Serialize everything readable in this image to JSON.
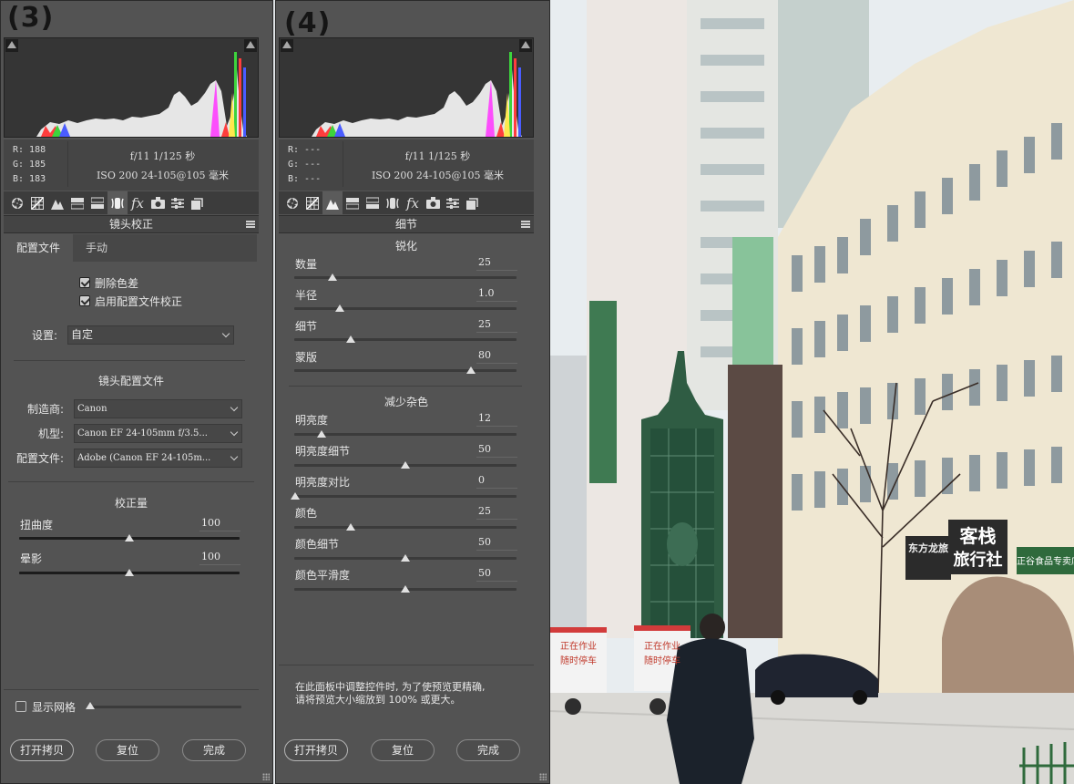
{
  "left": {
    "step": "(3)",
    "rgb": {
      "r": "R: 188",
      "g": "G: 185",
      "b": "B: 183"
    },
    "exif": {
      "line1": "f/11  1/125 秒",
      "line2": "ISO 200  24-105@105 毫米"
    },
    "panel_title": "镜头校正",
    "tabs": {
      "profile": "配置文件",
      "manual": "手动"
    },
    "checks": {
      "remove_ca": "删除色差",
      "enable_profile": "启用配置文件校正"
    },
    "setup": {
      "label": "设置:",
      "value": "自定"
    },
    "lens_profile": {
      "heading": "镜头配置文件",
      "make_label": "制造商:",
      "make_value": "Canon",
      "model_label": "机型:",
      "model_value": "Canon EF 24-105mm f/3.5...",
      "profile_label": "配置文件:",
      "profile_value": "Adobe (Canon EF 24-105m..."
    },
    "correction": {
      "heading": "校正量",
      "distortion_label": "扭曲度",
      "distortion_value": "100",
      "vignetting_label": "晕影",
      "vignetting_value": "100"
    },
    "grid_label": "显示网格",
    "buttons": {
      "open_copy": "打开拷贝",
      "reset": "复位",
      "done": "完成"
    }
  },
  "right": {
    "step": "(4)",
    "rgb": {
      "r": "R: ---",
      "g": "G: ---",
      "b": "B: ---"
    },
    "exif": {
      "line1": "f/11  1/125 秒",
      "line2": "ISO 200  24-105@105 毫米"
    },
    "panel_title": "细节",
    "sharpening": {
      "heading": "锐化",
      "amount_label": "数量",
      "amount_value": "25",
      "radius_label": "半径",
      "radius_value": "1.0",
      "detail_label": "细节",
      "detail_value": "25",
      "masking_label": "蒙版",
      "masking_value": "80"
    },
    "noise": {
      "heading": "减少杂色",
      "lum_label": "明亮度",
      "lum_value": "12",
      "lum_detail_label": "明亮度细节",
      "lum_detail_value": "50",
      "lum_contrast_label": "明亮度对比",
      "lum_contrast_value": "0",
      "color_label": "颜色",
      "color_value": "25",
      "color_detail_label": "颜色细节",
      "color_detail_value": "50",
      "color_smooth_label": "颜色平滑度",
      "color_smooth_value": "50"
    },
    "note_line1": "在此面板中调整控件时, 为了使预览更精确,",
    "note_line2": "请将预览大小缩放到 100% 或更大。",
    "buttons": {
      "open_copy": "打开拷贝",
      "reset": "复位",
      "done": "完成"
    }
  },
  "photo": {
    "sign1": "客栈",
    "sign2": "旅行社",
    "sign3": "东方龙旅",
    "sign4": "正谷食品专卖店",
    "truck1_line1": "正在作业",
    "truck1_line2": "随时停车",
    "truck2_line1": "正在作业",
    "truck2_line2": "随时停车"
  },
  "colors": {
    "panel": "#535353",
    "accent_sign": "#2b2b2b"
  }
}
